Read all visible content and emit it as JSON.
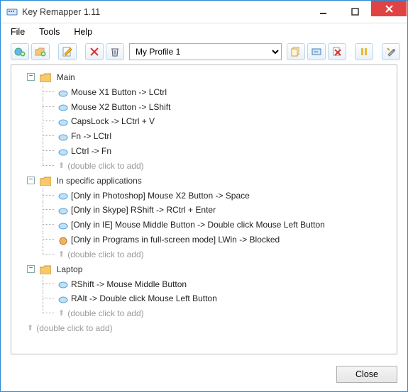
{
  "window": {
    "title": "Key Remapper 1.11"
  },
  "menu": {
    "file": "File",
    "tools": "Tools",
    "help": "Help"
  },
  "toolbar": {
    "profile_selected": "My Profile 1"
  },
  "tree": {
    "hint": "(double click to add)",
    "folders": [
      {
        "name": "Main",
        "items": [
          "Mouse X1 Button -> LCtrl",
          "Mouse X2 Button -> LShift",
          "CapsLock -> LCtrl + V",
          "Fn -> LCtrl",
          "LCtrl -> Fn"
        ]
      },
      {
        "name": "In specific applications",
        "items": [
          "[Only in Photoshop] Mouse X2 Button -> Space",
          "[Only in Skype] RShift -> RCtrl + Enter",
          "[Only in IE] Mouse Middle Button -> Double click Mouse Left Button",
          "[Only in Programs in full-screen mode] LWin -> Blocked"
        ]
      },
      {
        "name": "Laptop",
        "items": [
          "RShift -> Mouse Middle Button",
          "RAlt -> Double click Mouse Left Button"
        ]
      }
    ]
  },
  "footer": {
    "close": "Close"
  }
}
